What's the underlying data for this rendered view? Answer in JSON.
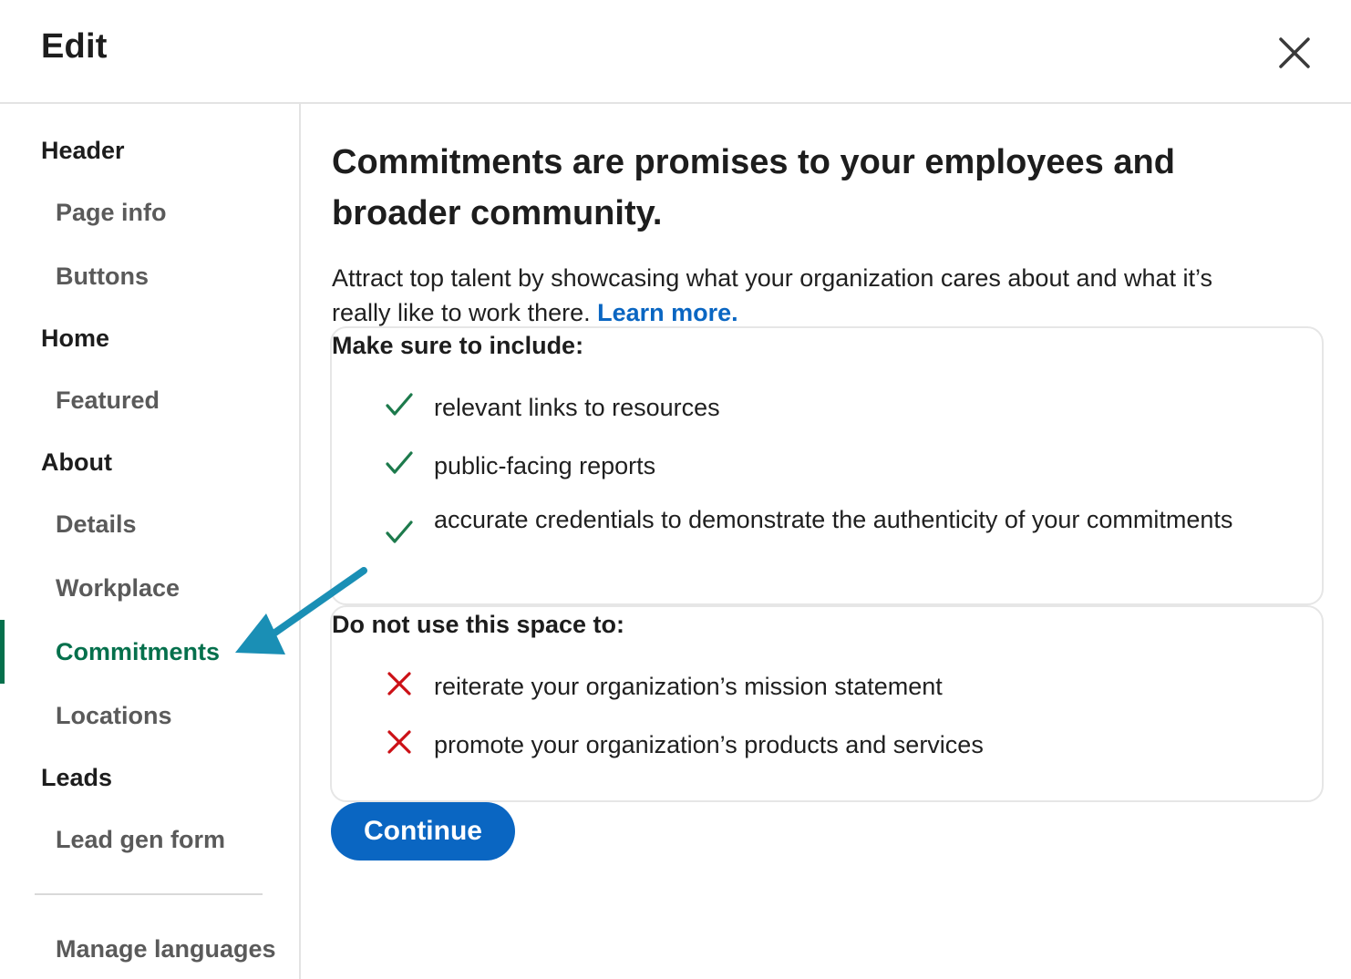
{
  "header": {
    "title": "Edit"
  },
  "sidebar": {
    "items": [
      {
        "label": "Header"
      },
      {
        "label": "Page info"
      },
      {
        "label": "Buttons"
      },
      {
        "label": "Home"
      },
      {
        "label": "Featured"
      },
      {
        "label": "About"
      },
      {
        "label": "Details"
      },
      {
        "label": "Workplace"
      },
      {
        "label": "Commitments",
        "active": true
      },
      {
        "label": "Locations"
      },
      {
        "label": "Leads"
      },
      {
        "label": "Lead gen form"
      },
      {
        "label": "Manage languages"
      }
    ]
  },
  "main": {
    "heading": "Commitments are promises to your employees and broader community.",
    "intro_text": "Attract top talent by showcasing what your organization cares about and what it’s really like to work there.",
    "learn_more": "Learn more.",
    "include_box": {
      "title": "Make sure to include:",
      "items": [
        "relevant links to resources",
        "public-facing reports",
        "accurate credentials to demonstrate the authenticity of your commitments"
      ]
    },
    "avoid_box": {
      "title": "Do not use this space to:",
      "items": [
        "reiterate your organization’s mission statement",
        "promote your organization’s products and services"
      ]
    },
    "continue_label": "Continue"
  },
  "colors": {
    "accent_blue": "#0a66c2",
    "active_green": "#05704c",
    "check_green": "#1d7a4c",
    "cross_red": "#cc1016",
    "annotation_arrow": "#1a8fb5"
  },
  "icons": {
    "close": "close-icon",
    "include": "checkmark-icon",
    "avoid": "cross-icon",
    "annotation": "annotation-arrow"
  }
}
